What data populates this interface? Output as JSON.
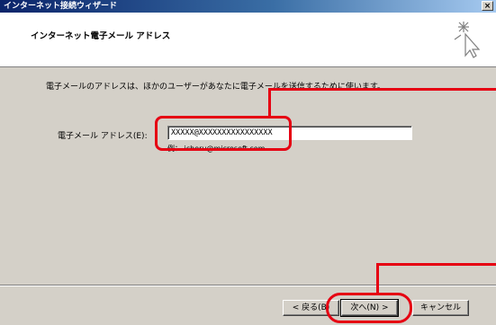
{
  "window": {
    "title": "インターネット接続ウィザード",
    "close_label": "×"
  },
  "header": {
    "title": "インターネット電子メール アドレス"
  },
  "main": {
    "description": "電子メールのアドレスは、ほかのユーザーがあなたに電子メールを送信するために使います。",
    "email_label": "電子メール アドレス(E):",
    "email_value": "XXXXX@XXXXXXXXXXXXXXXX",
    "example": "例： ichoru@microsoft.com"
  },
  "footer": {
    "back_label": "< 戻る(B)",
    "next_label": "次へ(N) >",
    "cancel_label": "キャンセル"
  },
  "colors": {
    "annotation": "#e60012",
    "titlebar": "#0a246a",
    "dialog_bg": "#d4d0c8"
  }
}
